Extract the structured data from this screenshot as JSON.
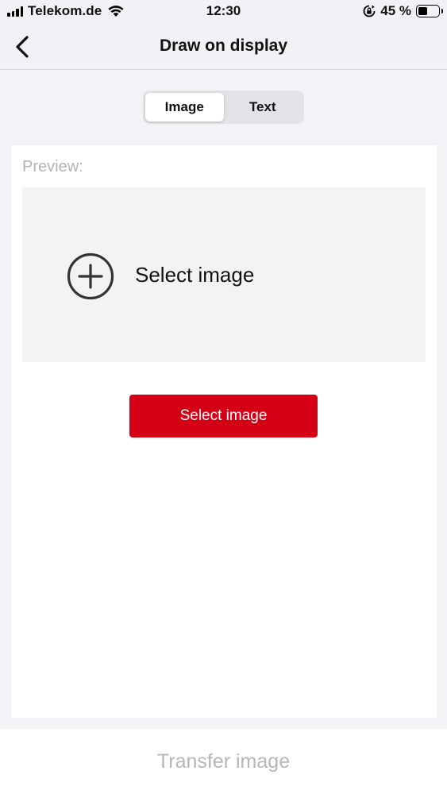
{
  "status_bar": {
    "carrier": "Telekom.de",
    "time": "12:30",
    "battery_percent": "45 %",
    "battery_level": 0.45,
    "icons": [
      "signal-icon",
      "wifi-icon",
      "rotation-lock-icon",
      "battery-icon"
    ]
  },
  "nav": {
    "title": "Draw on display",
    "back_icon": "chevron-left-icon"
  },
  "segmented": {
    "options": [
      "Image",
      "Text"
    ],
    "selected": "Image"
  },
  "card": {
    "preview_label": "Preview:",
    "preview_select_label": "Select image",
    "preview_icon": "add-circle-icon",
    "select_button_label": "Select image"
  },
  "footer": {
    "transfer_label": "Transfer image"
  },
  "colors": {
    "accent": "#d50015",
    "background": "#f3f2f7",
    "disabled_text": "#b6b6b8"
  }
}
